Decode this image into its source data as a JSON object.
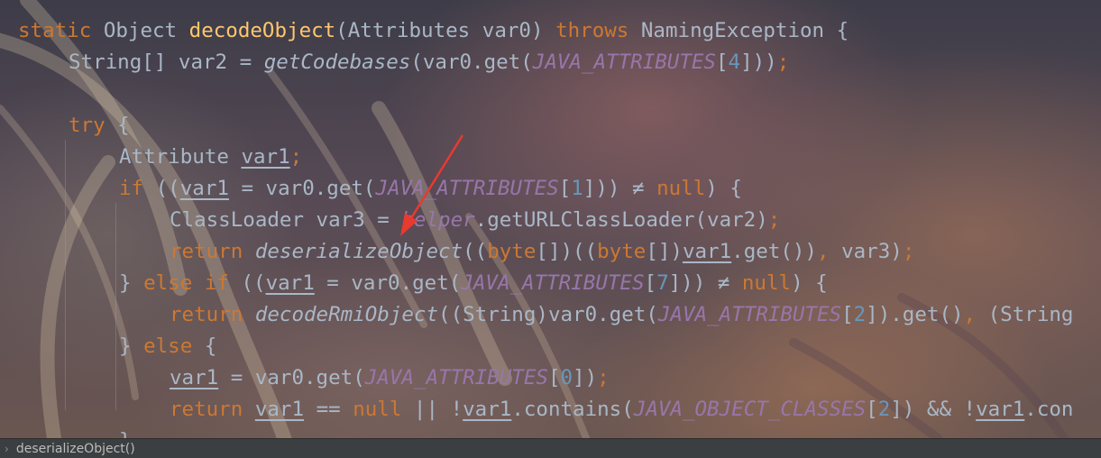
{
  "editor": {
    "lines": [
      {
        "indent": 0,
        "tokens": [
          {
            "t": "static",
            "c": "kw"
          },
          {
            "t": " ",
            "c": "id"
          },
          {
            "t": "Object",
            "c": "id"
          },
          {
            "t": " ",
            "c": "id"
          },
          {
            "t": "decodeObject",
            "c": "fn"
          },
          {
            "t": "(Attributes var0) ",
            "c": "id"
          },
          {
            "t": "throws",
            "c": "kw"
          },
          {
            "t": " NamingException {",
            "c": "id"
          }
        ]
      },
      {
        "indent": 1,
        "tokens": [
          {
            "t": "String[] var2 = ",
            "c": "id"
          },
          {
            "t": "getCodebases",
            "c": "italic"
          },
          {
            "t": "(var0.get(",
            "c": "id"
          },
          {
            "t": "JAVA_ATTRIBUTES",
            "c": "const"
          },
          {
            "t": "[",
            "c": "id"
          },
          {
            "t": "4",
            "c": "num"
          },
          {
            "t": "]))",
            "c": "id"
          },
          {
            "t": ";",
            "c": "semi"
          }
        ]
      },
      {
        "indent": 0,
        "tokens": []
      },
      {
        "indent": 1,
        "tokens": [
          {
            "t": "try",
            "c": "kw"
          },
          {
            "t": " {",
            "c": "id"
          }
        ]
      },
      {
        "indent": 2,
        "tokens": [
          {
            "t": "Attribute ",
            "c": "id"
          },
          {
            "t": "var1",
            "c": "var"
          },
          {
            "t": ";",
            "c": "semi"
          }
        ]
      },
      {
        "indent": 2,
        "tokens": [
          {
            "t": "if",
            "c": "kw"
          },
          {
            "t": " ((",
            "c": "id"
          },
          {
            "t": "var1",
            "c": "var"
          },
          {
            "t": " = var0.get(",
            "c": "id"
          },
          {
            "t": "JAVA_ATTRIBUTES",
            "c": "const"
          },
          {
            "t": "[",
            "c": "id"
          },
          {
            "t": "1",
            "c": "num"
          },
          {
            "t": "])) ",
            "c": "id"
          },
          {
            "t": "≠",
            "c": "op"
          },
          {
            "t": " ",
            "c": "id"
          },
          {
            "t": "null",
            "c": "kw"
          },
          {
            "t": ") {",
            "c": "id"
          }
        ]
      },
      {
        "indent": 3,
        "tokens": [
          {
            "t": "ClassLoader var3 = ",
            "c": "id"
          },
          {
            "t": "helper",
            "c": "const"
          },
          {
            "t": ".getURLClassLoader(var2)",
            "c": "id"
          },
          {
            "t": ";",
            "c": "semi"
          }
        ]
      },
      {
        "indent": 3,
        "tokens": [
          {
            "t": "return",
            "c": "kw"
          },
          {
            "t": " ",
            "c": "id"
          },
          {
            "t": "deserializeObject",
            "c": "italic"
          },
          {
            "t": "((",
            "c": "id"
          },
          {
            "t": "byte",
            "c": "kw"
          },
          {
            "t": "[])((",
            "c": "id"
          },
          {
            "t": "byte",
            "c": "kw"
          },
          {
            "t": "[])",
            "c": "id"
          },
          {
            "t": "var1",
            "c": "var"
          },
          {
            "t": ".get())",
            "c": "id"
          },
          {
            "t": ",",
            "c": "semi"
          },
          {
            "t": " var3)",
            "c": "id"
          },
          {
            "t": ";",
            "c": "semi"
          }
        ]
      },
      {
        "indent": 2,
        "tokens": [
          {
            "t": "} ",
            "c": "id"
          },
          {
            "t": "else",
            "c": "kw"
          },
          {
            "t": " ",
            "c": "id"
          },
          {
            "t": "if",
            "c": "kw"
          },
          {
            "t": " ((",
            "c": "id"
          },
          {
            "t": "var1",
            "c": "var"
          },
          {
            "t": " = var0.get(",
            "c": "id"
          },
          {
            "t": "JAVA_ATTRIBUTES",
            "c": "const"
          },
          {
            "t": "[",
            "c": "id"
          },
          {
            "t": "7",
            "c": "num"
          },
          {
            "t": "])) ",
            "c": "id"
          },
          {
            "t": "≠",
            "c": "op"
          },
          {
            "t": " ",
            "c": "id"
          },
          {
            "t": "null",
            "c": "kw"
          },
          {
            "t": ") {",
            "c": "id"
          }
        ]
      },
      {
        "indent": 3,
        "tokens": [
          {
            "t": "return",
            "c": "kw"
          },
          {
            "t": " ",
            "c": "id"
          },
          {
            "t": "decodeRmiObject",
            "c": "italic"
          },
          {
            "t": "((String)var0.get(",
            "c": "id"
          },
          {
            "t": "JAVA_ATTRIBUTES",
            "c": "const"
          },
          {
            "t": "[",
            "c": "id"
          },
          {
            "t": "2",
            "c": "num"
          },
          {
            "t": "]).get()",
            "c": "id"
          },
          {
            "t": ",",
            "c": "semi"
          },
          {
            "t": " (String",
            "c": "id"
          }
        ]
      },
      {
        "indent": 2,
        "tokens": [
          {
            "t": "} ",
            "c": "id"
          },
          {
            "t": "else",
            "c": "kw"
          },
          {
            "t": " {",
            "c": "id"
          }
        ]
      },
      {
        "indent": 3,
        "tokens": [
          {
            "t": "var1",
            "c": "var"
          },
          {
            "t": " = var0.get(",
            "c": "id"
          },
          {
            "t": "JAVA_ATTRIBUTES",
            "c": "const"
          },
          {
            "t": "[",
            "c": "id"
          },
          {
            "t": "0",
            "c": "num"
          },
          {
            "t": "])",
            "c": "id"
          },
          {
            "t": ";",
            "c": "semi"
          }
        ]
      },
      {
        "indent": 3,
        "tokens": [
          {
            "t": "return",
            "c": "kw"
          },
          {
            "t": " ",
            "c": "id"
          },
          {
            "t": "var1",
            "c": "var"
          },
          {
            "t": " ",
            "c": "id"
          },
          {
            "t": "==",
            "c": "op"
          },
          {
            "t": " ",
            "c": "id"
          },
          {
            "t": "null",
            "c": "kw"
          },
          {
            "t": " || !",
            "c": "id"
          },
          {
            "t": "var1",
            "c": "var"
          },
          {
            "t": ".contains(",
            "c": "id"
          },
          {
            "t": "JAVA_OBJECT_CLASSES",
            "c": "const"
          },
          {
            "t": "[",
            "c": "id"
          },
          {
            "t": "2",
            "c": "num"
          },
          {
            "t": "]) && !",
            "c": "id"
          },
          {
            "t": "var1",
            "c": "var"
          },
          {
            "t": ".con",
            "c": "id"
          }
        ]
      },
      {
        "indent": 2,
        "tokens": [
          {
            "t": "}",
            "c": "id"
          }
        ]
      }
    ]
  },
  "breadcrumb": {
    "chevron": "›",
    "label": "deserializeObject()"
  },
  "colors": {
    "keyword": "#cc7832",
    "function": "#ffc66d",
    "identifier": "#a9b7c6",
    "constant": "#9876aa",
    "number": "#6897bb",
    "arrow": "#e83a30"
  }
}
